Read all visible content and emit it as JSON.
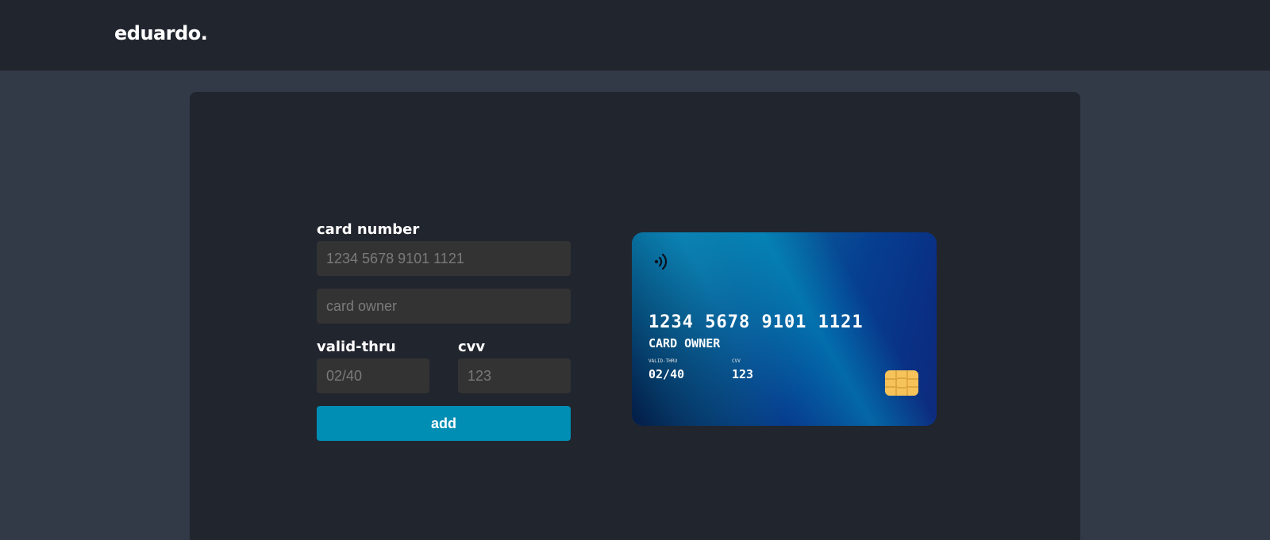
{
  "header": {
    "logo": "eduardo."
  },
  "form": {
    "card_number_label": "card number",
    "card_number_placeholder": "1234 5678 9101 1121",
    "card_owner_placeholder": "card owner",
    "valid_thru_label": "valid-thru",
    "valid_thru_placeholder": "02/40",
    "cvv_label": "cvv",
    "cvv_placeholder": "123",
    "add_label": "add"
  },
  "card": {
    "number": "1234 5678 9101 1121",
    "owner": "CARD OWNER",
    "valid_thru_label": "VALID-THRU",
    "valid_thru": "02/40",
    "cvv_label": "CVV",
    "cvv": "123",
    "icons": [
      "contactless-icon",
      "chip-icon"
    ]
  },
  "colors": {
    "page_bg": "#323947",
    "panel_bg": "#21252e",
    "input_bg": "#333333",
    "button_bg": "#008eb4",
    "chip": "#f6c25a"
  }
}
